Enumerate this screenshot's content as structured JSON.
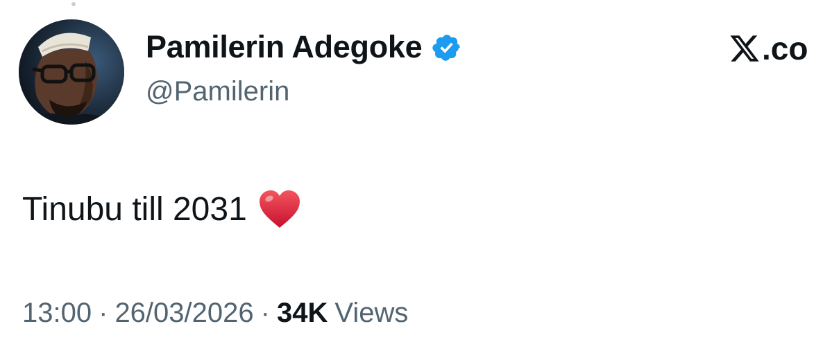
{
  "author": {
    "display_name": "Pamilerin Adegoke",
    "handle": "@Pamilerin",
    "verified": true,
    "avatar_icon": "profile-photo",
    "verified_icon": "verified-badge-icon"
  },
  "brand": {
    "label": ".co",
    "icon": "x-logo-icon"
  },
  "tweet": {
    "text": "Tinubu till 2031",
    "emoji_icon": "red-heart-icon"
  },
  "meta": {
    "time": "13:00",
    "separator": "·",
    "date": "26/03/2026",
    "views_count": "34K",
    "views_label": "Views"
  },
  "colors": {
    "text_primary": "#0f1419",
    "text_secondary": "#536471",
    "verified_blue": "#1d9bf0",
    "heart_red": "#e0243a"
  }
}
